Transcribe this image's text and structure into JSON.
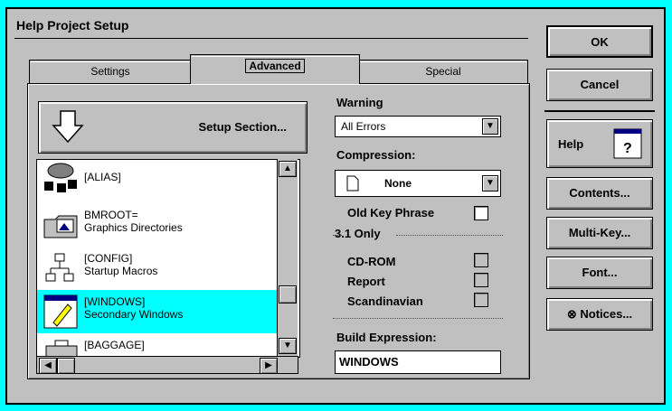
{
  "dialog": {
    "title": "Help Project Setup"
  },
  "tabs": [
    {
      "label": "Settings"
    },
    {
      "label": "Advanced"
    },
    {
      "label": "Special"
    }
  ],
  "setup_button": {
    "label": "Setup Section..."
  },
  "list": {
    "items": [
      {
        "line1": "[ALIAS]",
        "line2": "",
        "icon": "alias-icon"
      },
      {
        "line1": "BMROOT=",
        "line2": "Graphics Directories",
        "icon": "graphics-folder-icon"
      },
      {
        "line1": "[CONFIG]",
        "line2": "Startup Macros",
        "icon": "config-tree-icon"
      },
      {
        "line1": "[WINDOWS]",
        "line2": "Secondary Windows",
        "icon": "window-pen-icon"
      },
      {
        "line1": "[BAGGAGE]",
        "line2": "",
        "icon": "baggage-icon"
      }
    ]
  },
  "warning": {
    "label": "Warning",
    "value": "All Errors"
  },
  "compression": {
    "label": "Compression:",
    "value": "None"
  },
  "old_key_phrase": {
    "label": "Old Key Phrase"
  },
  "group31": {
    "label": "3.1 Only"
  },
  "options": [
    {
      "label": "CD-ROM"
    },
    {
      "label": "Report"
    },
    {
      "label": "Scandinavian"
    }
  ],
  "build_expression": {
    "label": "Build Expression:",
    "value": "WINDOWS"
  },
  "buttons": {
    "ok": "OK",
    "cancel": "Cancel",
    "help": "Help",
    "contents": "Contents...",
    "multikey": "Multi-Key...",
    "font": "Font...",
    "notices": "Notices..."
  },
  "colors": {
    "background": "#00ffff",
    "selection": "#00ffff",
    "face": "#c0c0c0"
  }
}
